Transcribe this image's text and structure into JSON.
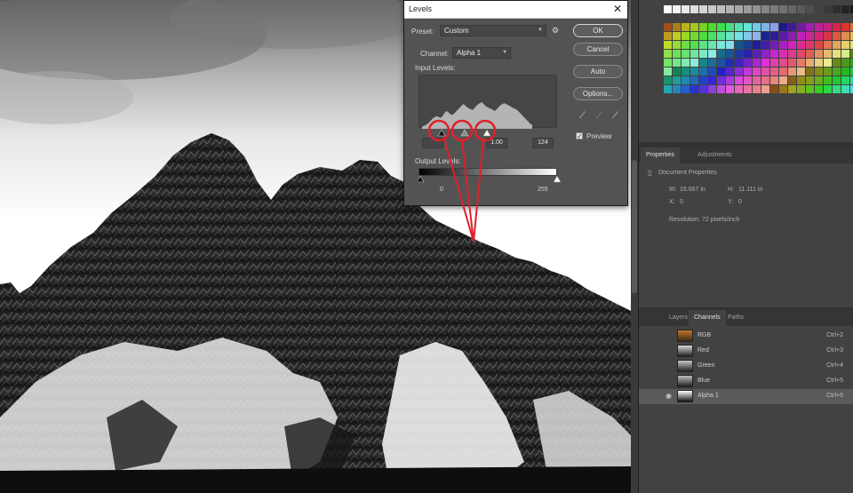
{
  "levels_dialog": {
    "title": "Levels",
    "close_glyph": "✕",
    "preset_label": "Preset:",
    "preset_value": "Custom",
    "channel_label": "Channel:",
    "channel_value": "Alpha 1",
    "input_levels_label": "Input Levels:",
    "input_black": "",
    "input_mid": "1.00",
    "input_white": "124",
    "output_levels_label": "Output Levels:",
    "output_black": "0",
    "output_white": "255",
    "ok_label": "OK",
    "cancel_label": "Cancel",
    "auto_label": "Auto",
    "options_label": "Options...",
    "preview_label": "Preview",
    "preview_checked": true,
    "histogram": [
      2,
      3,
      4,
      5,
      7,
      9,
      11,
      12,
      13,
      12,
      11,
      13,
      16,
      18,
      17,
      15,
      14,
      15,
      17,
      19,
      21,
      23,
      25,
      24,
      22,
      21,
      20,
      19,
      21,
      23,
      25,
      26,
      27,
      25,
      23,
      22,
      21,
      20,
      19,
      18,
      20,
      22,
      24,
      25,
      26,
      25,
      24,
      23,
      22,
      21,
      20,
      19,
      17,
      15,
      13,
      11,
      9,
      7,
      5,
      4
    ]
  },
  "properties_panel": {
    "tabs": [
      "Properties",
      "Adjustments"
    ],
    "heading": "Document Properties",
    "w_label": "W:",
    "w_value": "16.667 in",
    "h_label": "H:",
    "h_value": "11.111 in",
    "x_label": "X:",
    "x_value": "0",
    "y_label": "Y:",
    "y_value": "0",
    "resolution": "Resolution: 72 pixels/inch"
  },
  "channels_panel": {
    "tabs": [
      "Layers",
      "Channels",
      "Paths"
    ],
    "rows": [
      {
        "name": "RGB",
        "shortcut": "Ctrl+2"
      },
      {
        "name": "Red",
        "shortcut": "Ctrl+3"
      },
      {
        "name": "Green",
        "shortcut": "Ctrl+4"
      },
      {
        "name": "Blue",
        "shortcut": "Ctrl+5"
      },
      {
        "name": "Alpha 1",
        "shortcut": "Ctrl+6"
      }
    ]
  },
  "colors": {
    "annotation": "#e0202a",
    "panel_bg": "#424242",
    "dialog_bg": "#535353"
  }
}
